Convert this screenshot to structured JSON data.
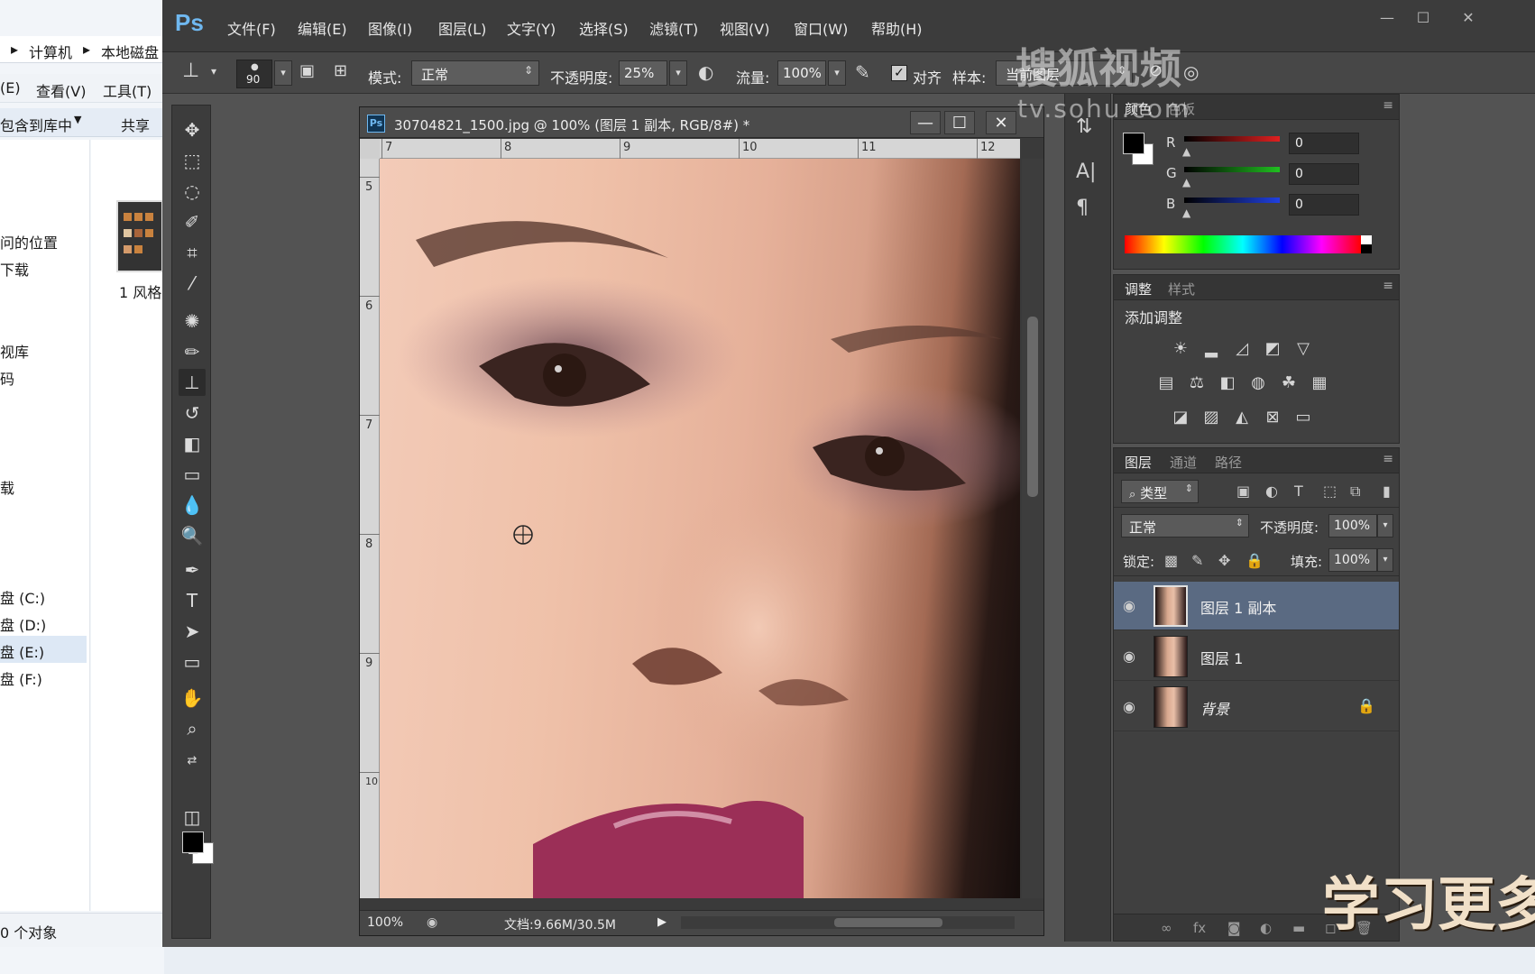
{
  "explorer": {
    "breadcrumb": [
      "计算机",
      "本地磁盘"
    ],
    "menu": [
      "(E)",
      "查看(V)",
      "工具(T)"
    ],
    "cmd": [
      "包含到库中",
      "共享"
    ],
    "nav_items": [
      "问的位置",
      "下载",
      "视库",
      "码",
      "载",
      "盘 (C:)",
      "盘 (D:)",
      "盘 (E:)",
      "盘 (F:)"
    ],
    "file_label": "1 风格",
    "status": "0 个对象"
  },
  "ps": {
    "logo": "Ps",
    "menu": [
      "文件(F)",
      "编辑(E)",
      "图像(I)",
      "图层(L)",
      "文字(Y)",
      "选择(S)",
      "滤镜(T)",
      "视图(V)",
      "窗口(W)",
      "帮助(H)"
    ],
    "window_controls": [
      "—",
      "☐",
      "✕"
    ],
    "options": {
      "brush_size": "90",
      "mode_label": "模式:",
      "mode_value": "正常",
      "opacity_label": "不透明度:",
      "opacity_value": "25%",
      "flow_label": "流量:",
      "flow_value": "100%",
      "align_label": "对齐",
      "sample_label": "样本:",
      "sample_value": "当前图层"
    },
    "document": {
      "title": "30704821_1500.jpg @ 100% (图层 1 副本, RGB/8#) *",
      "ruler_h": [
        "7",
        "8",
        "9",
        "10",
        "11",
        "12"
      ],
      "ruler_v": [
        "5",
        "6",
        "7",
        "8",
        "9",
        "10"
      ],
      "zoom": "100%",
      "doc_size": "文档:9.66M/30.5M"
    },
    "color_panel": {
      "tabs": [
        "颜色",
        "色板"
      ],
      "channels": [
        {
          "label": "R",
          "value": "0",
          "color": "#e02020"
        },
        {
          "label": "G",
          "value": "0",
          "color": "#20c020"
        },
        {
          "label": "B",
          "value": "0",
          "color": "#2040e0"
        }
      ]
    },
    "adjust_panel": {
      "tabs": [
        "调整",
        "样式"
      ],
      "title": "添加调整"
    },
    "layers_panel": {
      "tabs": [
        "图层",
        "通道",
        "路径"
      ],
      "filter_label": "类型",
      "blend_mode": "正常",
      "opacity_label": "不透明度:",
      "opacity_value": "100%",
      "lock_label": "锁定:",
      "fill_label": "填充:",
      "fill_value": "100%",
      "layers": [
        {
          "name": "图层 1 副本",
          "selected": true
        },
        {
          "name": "图层 1",
          "selected": false
        },
        {
          "name": "背景",
          "selected": false,
          "locked": true
        }
      ]
    }
  },
  "watermark": {
    "brand": "搜狐视频",
    "url": "tv.sohu.com",
    "bottom_text": "学习更多"
  }
}
